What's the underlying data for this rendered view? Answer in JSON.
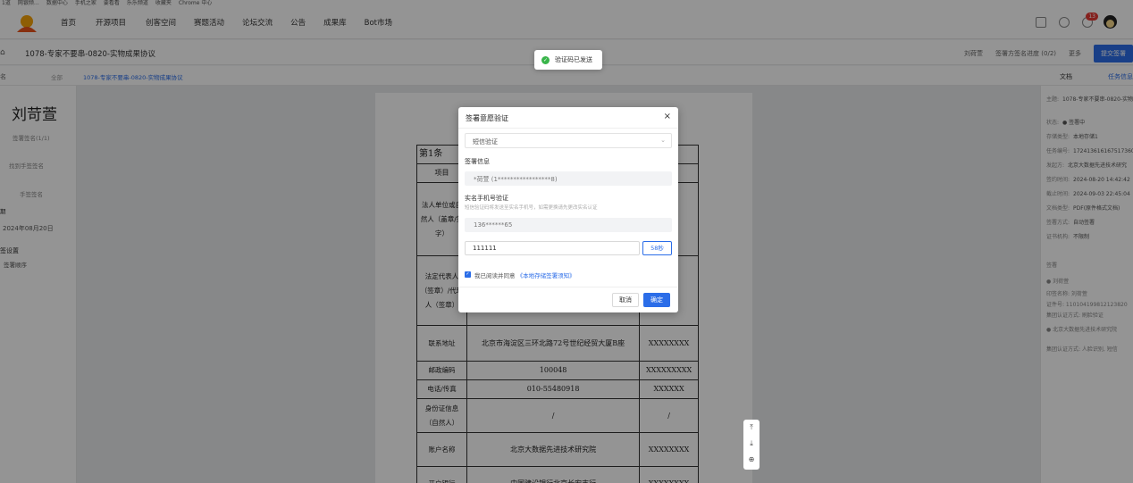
{
  "bookmarks": [
    "1道",
    "网银频…",
    "数据中心",
    "手机之家",
    "要看看",
    "乐乐频道",
    "收藏夹",
    "Chrome 中心"
  ],
  "nav": [
    "首页",
    "开源项目",
    "创客空间",
    "赛题活动",
    "论坛交流",
    "公告",
    "成果库",
    "Bot市场"
  ],
  "notif_count": "13",
  "doc_title": "1078-专家不要串-0820-实物成果协议",
  "subbar_right": [
    "刘荷萱",
    "签署方签名进度 (0/2)",
    "更多"
  ],
  "subbar_btn": "提交签署",
  "toast": "验证码已发送",
  "tabbar": {
    "left": "名",
    "all": "全部",
    "file": "1078-专家不要串-0820-实物成果协议",
    "r1": "文档",
    "r2": "任务信息"
  },
  "left_panel": {
    "signature": "刘苛萱",
    "t1": "签署签名(1/1)",
    "t2": "找到手签签名",
    "t3": "手签签名",
    "t4": "期",
    "date": "2024年08月20日",
    "t5": "签设置",
    "t6": "签署顺序"
  },
  "contract": {
    "heading": "第1条",
    "col_item": "项目",
    "rows": [
      {
        "label": "法人单位或自然人（盖章/签字）",
        "v1": "",
        "v2": ""
      },
      {
        "label": "法定代表人（签章）/代理人（签章）",
        "v1": "",
        "v2": ""
      },
      {
        "label": "联系地址",
        "v1": "北京市海淀区三环北路72号世纪经贸大厦B座",
        "v2": "XXXXXXXX"
      },
      {
        "label": "邮政编码",
        "v1": "100048",
        "v2": "XXXXXXXXX"
      },
      {
        "label": "电话/传真",
        "v1": "010-55480918",
        "v2": "XXXXXX"
      },
      {
        "label": "身份证信息（自然人）",
        "v1": "/",
        "v2": "/"
      },
      {
        "label": "账户名称",
        "v1": "北京大数据先进技术研究院",
        "v2": "XXXXXXXX"
      },
      {
        "label": "开户银行",
        "v1": "中国建设银行北京长安支行",
        "v2": "XXXXXXXX"
      }
    ]
  },
  "right_panel": [
    [
      "主题:",
      "1078-专家不要串-0820-实物成果协议"
    ],
    [
      "状态:",
      "● 签署中"
    ],
    [
      "存储类型:",
      "本地存储1"
    ],
    [
      "任务编号:",
      "1724136161675173607"
    ],
    [
      "发起方:",
      "北京大数据先进技术研究"
    ],
    [
      "签约时间:",
      "2024-08-20 14:42:42"
    ],
    [
      "截止时间:",
      "2024-09-03 22:45:04"
    ],
    [
      "文档类型:",
      "PDF(原件格式文档)"
    ],
    [
      "签署方式:",
      "自动签署"
    ],
    [
      "证书机构:",
      "不限制"
    ],
    [
      "签署",
      ""
    ],
    [
      "● 刘荷萱",
      ""
    ],
    [
      "印签名称: 刘荷萱",
      ""
    ],
    [
      "证件号: 110104199812123820",
      ""
    ],
    [
      "集团认证方式: 刷脸验证",
      ""
    ],
    [
      "● 北京大数据先进技术研究院",
      ""
    ],
    [
      "集团认证方式: 人脸识别, 短信",
      ""
    ]
  ],
  "modal": {
    "title": "签署意愿验证",
    "close": "×",
    "method": "短信验证",
    "signer_label": "签署信息",
    "signer_value": "*荷萱 (1*****************8)",
    "phone_label": "实名手机号验证",
    "phone_hint": "短信验证码将发送至实名手机号，如需更换请先更改实名认证",
    "phone_value": "136******65",
    "code_value": "111111",
    "countdown": "58秒",
    "agree_prefix": "我已阅读并同意",
    "agree_link": "《本地存储签署须知》",
    "cancel": "取消",
    "ok": "确定"
  },
  "float_icons": [
    "top-icon",
    "download-icon",
    "zoom-icon"
  ]
}
